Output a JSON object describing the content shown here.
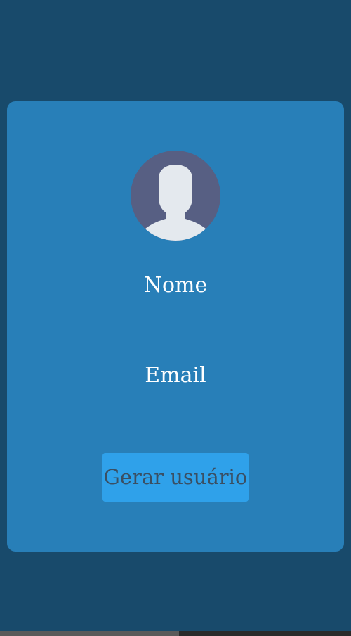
{
  "card": {
    "avatar_icon": "user-silhouette-icon",
    "name_label": "Nome",
    "email_label": "Email",
    "button_label": "Gerar usuário"
  },
  "colors": {
    "page_background": "#184a6b",
    "card_background": "#287fb8",
    "avatar_background": "#575f83",
    "avatar_silhouette": "#e4e9ee",
    "button_background": "#2fa1ea",
    "button_text": "#3a4f63"
  }
}
